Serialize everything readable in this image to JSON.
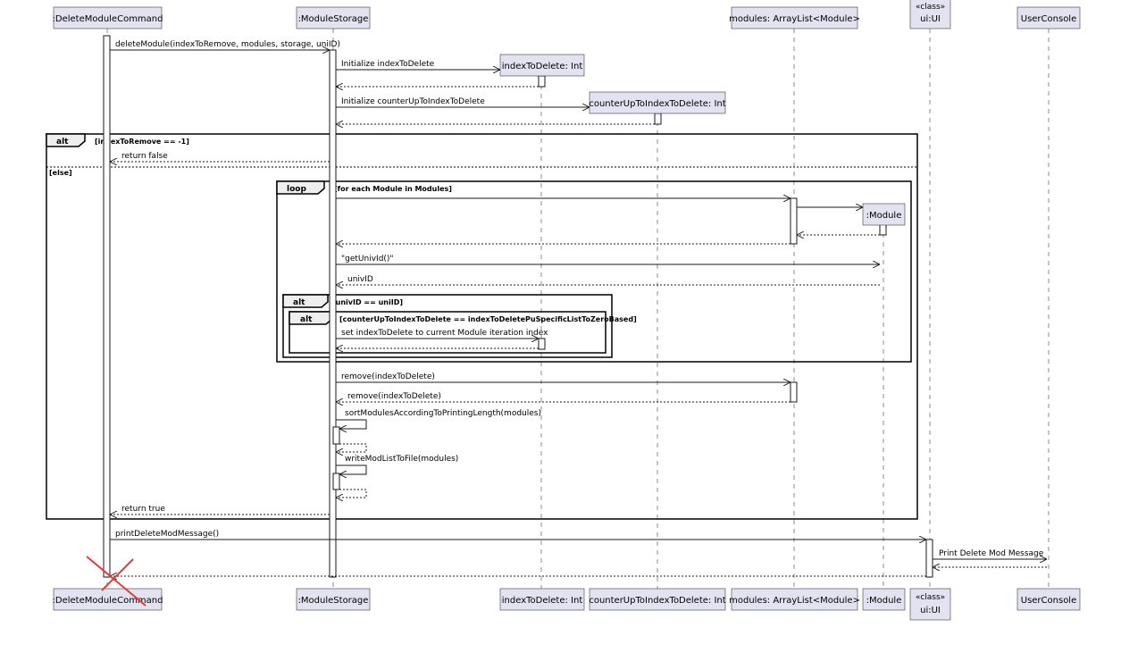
{
  "participants": [
    {
      "id": "dmc",
      "label": ":DeleteModuleCommand"
    },
    {
      "id": "ms",
      "label": ":ModuleStorage"
    },
    {
      "id": "itd",
      "label": "indexToDelete: Int"
    },
    {
      "id": "cut",
      "label": "counterUpToIndexToDelete: Int"
    },
    {
      "id": "mods",
      "label": "modules: ArrayList<Module>"
    },
    {
      "id": "mod",
      "label": ":Module"
    },
    {
      "id": "ui",
      "stereotype": "«class»",
      "label": "ui:UI"
    },
    {
      "id": "uc",
      "label": "UserConsole"
    }
  ],
  "messages": {
    "m1": "deleteModule(indexToRemove, modules, storage, uniID)",
    "m2": "Initialize indexToDelete",
    "m3": "Initialize counterUpToIndexToDelete",
    "m4": "return false",
    "m5": "\"getUnivId()\"",
    "m6": "univID",
    "m7": "set indexToDelete to current Module iteration index",
    "m8": "remove(indexToDelete)",
    "m9": "remove(indexToDelete)",
    "m10": "sortModulesAccordingToPrintingLength(modules)",
    "m11": "writeModListToFile(modules)",
    "m12": "return true",
    "m13": "printDeleteModMessage()",
    "m14": "Print Delete Mod Message"
  },
  "fragments": {
    "alt1": {
      "keyword": "alt",
      "guard": "[indexToRemove == -1]",
      "else": "[else]"
    },
    "loop": {
      "keyword": "loop",
      "guard": "[for each Module in Modules]"
    },
    "alt2": {
      "keyword": "alt",
      "guard": "[univID == uniID]"
    },
    "alt3": {
      "keyword": "alt",
      "guard": "[counterUpToIndexToDelete == indexToDeletePuSpecificListToZeroBased]"
    }
  }
}
